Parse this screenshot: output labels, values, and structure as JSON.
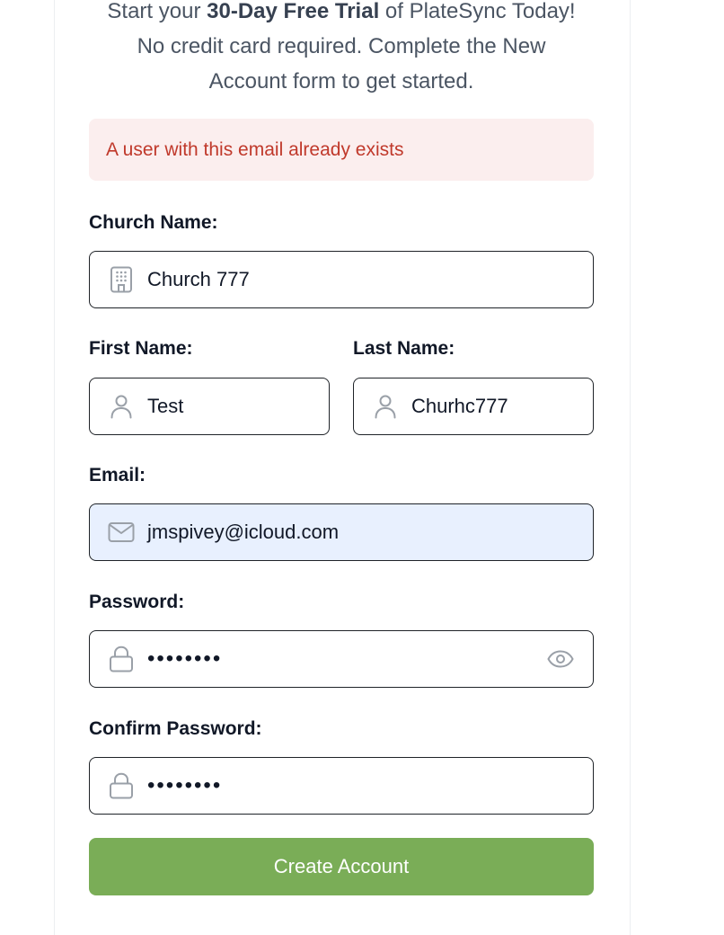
{
  "intro": {
    "prefix": "Start your ",
    "highlight": "30-Day Free Trial",
    "suffix": " of PlateSync Today!",
    "line2": "No credit card required. Complete the New",
    "line3": "Account form to get started."
  },
  "alert": {
    "message": "A user with this email already exists",
    "color": "#c0392b",
    "background": "#fbeeee"
  },
  "form": {
    "church_name": {
      "label": "Church Name:",
      "value": "Church 777",
      "icon": "building-icon"
    },
    "first_name": {
      "label": "First Name:",
      "value": "Test",
      "icon": "user-icon"
    },
    "last_name": {
      "label": "Last Name:",
      "value": "Churhc777",
      "icon": "user-icon"
    },
    "email": {
      "label": "Email:",
      "value": "jmspivey@icloud.com",
      "icon": "mail-icon"
    },
    "password": {
      "label": "Password:",
      "value": "••••••••",
      "icon": "lock-icon",
      "toggle_icon": "eye-icon"
    },
    "confirm_password": {
      "label": "Confirm Password:",
      "value": "••••••••",
      "icon": "lock-icon"
    }
  },
  "submit": {
    "label": "Create Account",
    "color": "#7aad57"
  }
}
